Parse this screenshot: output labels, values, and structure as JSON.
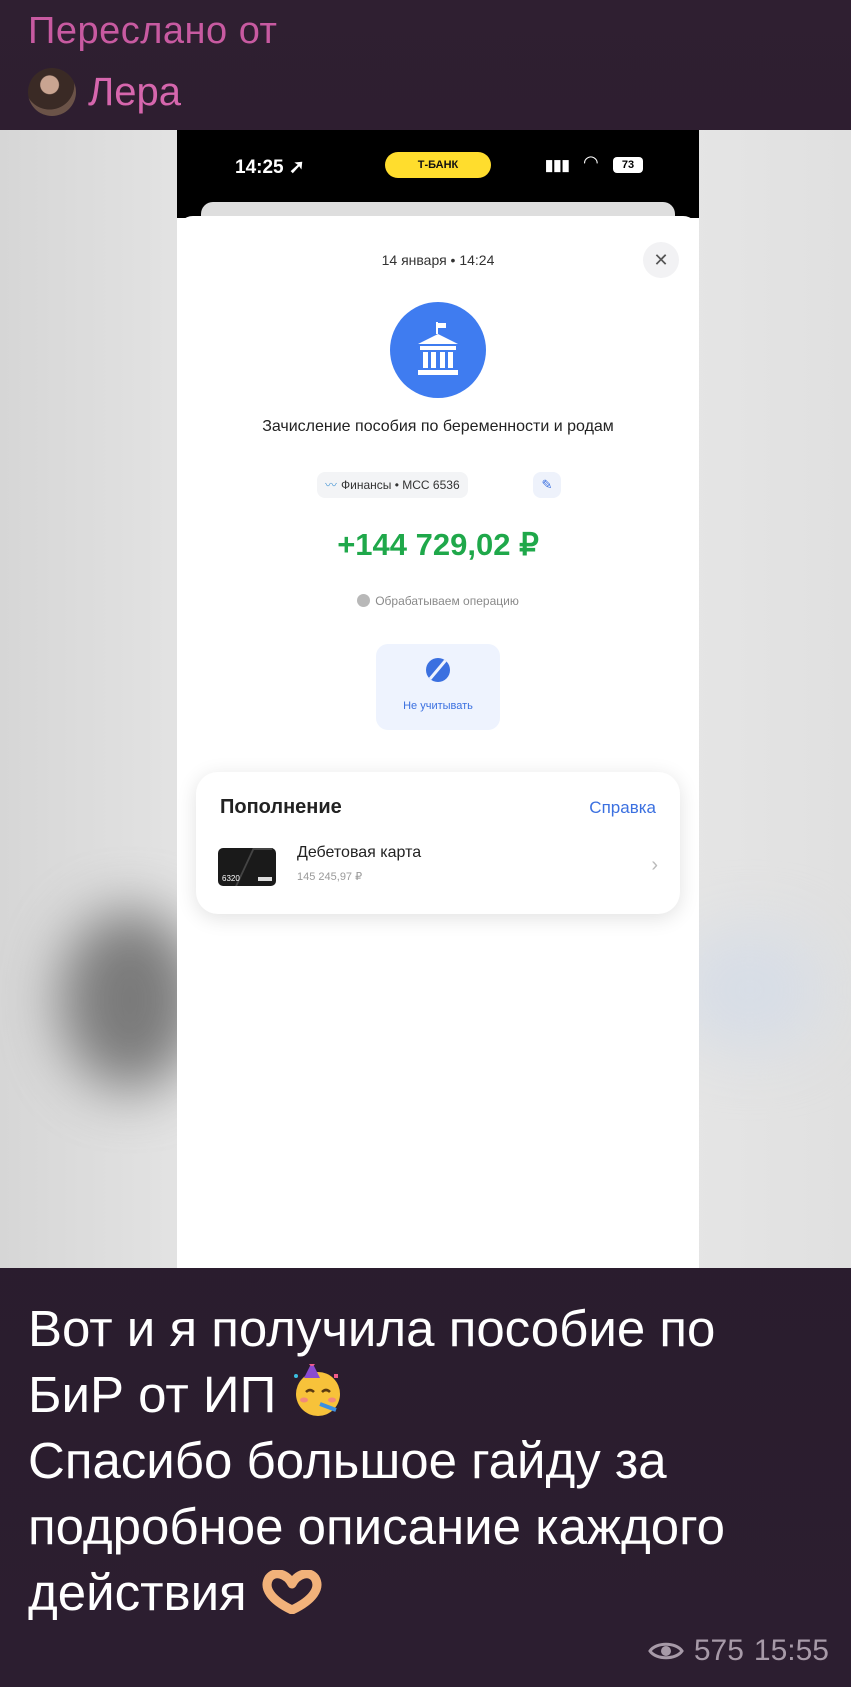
{
  "forward": {
    "label": "Переслано от",
    "from_name": "Лера"
  },
  "screenshot": {
    "status_bar": {
      "time": "14:25",
      "bank": "Т-БАНК",
      "battery": "73"
    },
    "operation": {
      "date": "14 января • 14:24",
      "title": "Зачисление пособия по беременности и родам",
      "category": "Финансы • MCC 6536",
      "amount": "+144 729,02 ₽",
      "status": "Обрабатываем операцию",
      "ignore_label": "Не учитывать"
    },
    "source": {
      "title": "Пополнение",
      "help_link": "Справка",
      "card_name": "Дебетовая карта",
      "card_balance": "145 245,97 ₽",
      "card_number": "6320"
    }
  },
  "caption": {
    "line1": "Вот и я получила пособие по",
    "line2": "БиР от ИП",
    "line3": "Спасибо большое гайду за",
    "line4": "подробное описание каждого",
    "line5": "действия"
  },
  "meta": {
    "views": "575",
    "time": "15:55"
  },
  "colors": {
    "forward_accent": "#c85aa1",
    "amount_green": "#1fa84a",
    "link_blue": "#3b70e0",
    "bank_yellow": "#ffdd2d"
  },
  "icons": [
    "avatar",
    "bank-building-icon",
    "close-icon",
    "chart-icon",
    "pencil-icon",
    "clock-icon",
    "eye-crossed-icon",
    "chevron-right-icon",
    "party-face-emoji",
    "heart-hands-emoji",
    "eye-icon"
  ]
}
